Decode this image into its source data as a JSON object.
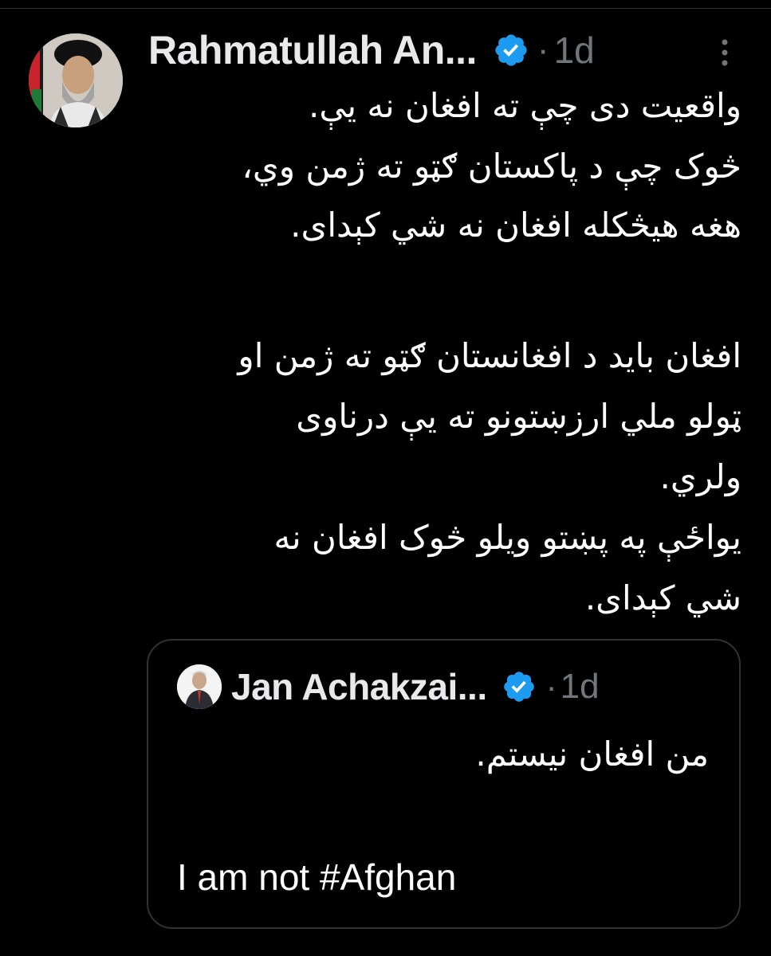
{
  "tweet": {
    "author_name": "Rahmatullah An...",
    "separator": "·",
    "time": "1d",
    "verified_icon": "verified-badge-icon",
    "more_icon": "more-vertical-icon",
    "lines": [
      "واقعیت دی چې ته افغان نه یې.",
      "څوک چې د پاکستان ګټو ته ژمن وي،",
      "هغه هیڅکله افغان نه شي کېدای.",
      "افغان باید د افغانستان ګټو ته ژمن او",
      "ټولو ملي ارزښتونو ته یې درناوی",
      "ولري.",
      "یواځې په پښتو ویلو څوک افغان نه",
      "شي کېدای."
    ]
  },
  "quoted_tweet": {
    "author_name": "Jan Achakzai...",
    "separator": "·",
    "time": "1d",
    "text_persian": "من افغان نیستم.",
    "text_english": "I am not #Afghan"
  },
  "colors": {
    "background": "#000000",
    "text": "#e7e9ea",
    "muted": "#71767b",
    "border": "#2f3336",
    "verified_blue": "#1d9bf0"
  }
}
